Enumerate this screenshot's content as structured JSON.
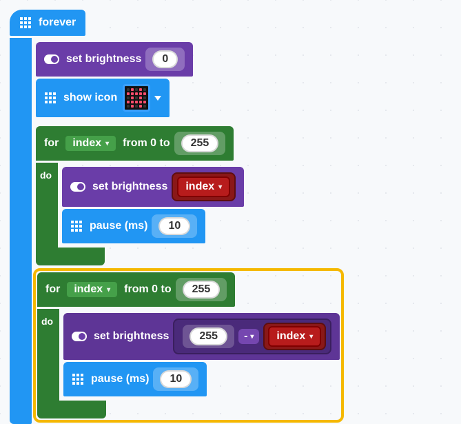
{
  "forever": {
    "label": "forever"
  },
  "setBrightness1": {
    "label": "set brightness",
    "value": "0"
  },
  "showIcon": {
    "label": "show icon",
    "pattern": [
      0,
      1,
      0,
      1,
      0,
      1,
      1,
      1,
      1,
      1,
      0,
      1,
      0,
      1,
      0,
      1,
      1,
      1,
      1,
      1,
      0,
      1,
      0,
      1,
      0
    ]
  },
  "for1": {
    "label_for": "for",
    "var": "index",
    "label_from": "from 0 to",
    "to": "255",
    "do": "do",
    "setBrightness": {
      "label": "set brightness",
      "var": "index"
    },
    "pause": {
      "label": "pause (ms)",
      "value": "10"
    }
  },
  "for2": {
    "label_for": "for",
    "var": "index",
    "label_from": "from 0 to",
    "to": "255",
    "do": "do",
    "setBrightness": {
      "label": "set brightness",
      "left": "255",
      "op": "-",
      "rightVar": "index"
    },
    "pause": {
      "label": "pause (ms)",
      "value": "10"
    }
  }
}
